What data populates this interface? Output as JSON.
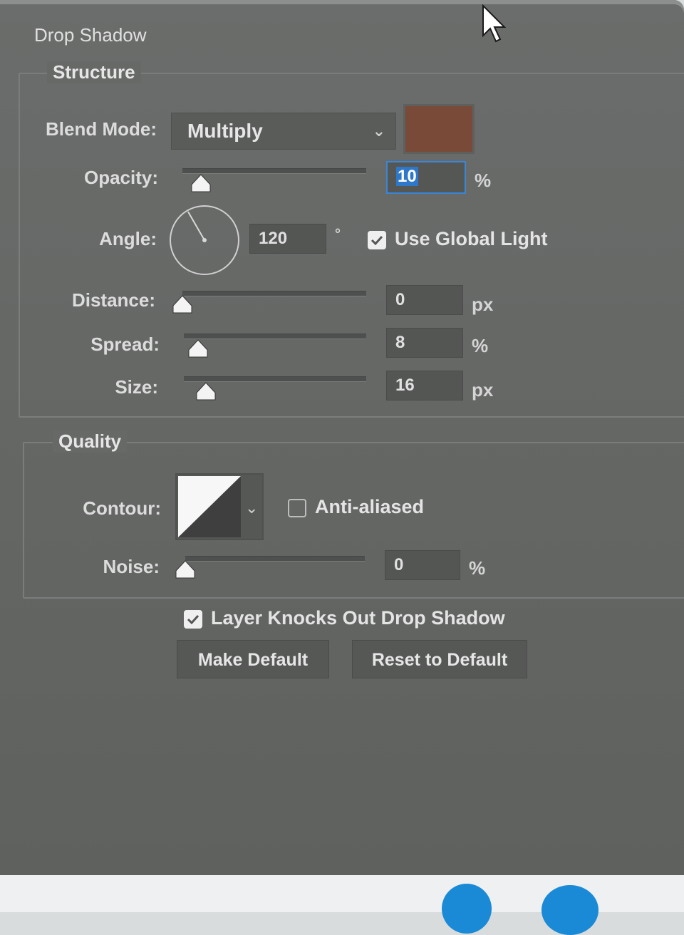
{
  "section": {
    "title": "Drop Shadow"
  },
  "structure": {
    "label": "Structure",
    "blend_mode": {
      "label": "Blend Mode:",
      "value": "Multiply",
      "color": "#7a4a38"
    },
    "opacity": {
      "label": "Opacity:",
      "value": "10",
      "unit": "%",
      "slider_fraction": 0.1
    },
    "angle": {
      "label": "Angle:",
      "value": "120",
      "unit": "°",
      "degrees": 120
    },
    "use_global_light": {
      "label": "Use Global Light",
      "checked": true
    },
    "distance": {
      "label": "Distance:",
      "value": "0",
      "unit": "px",
      "slider_fraction": 0.0
    },
    "spread": {
      "label": "Spread:",
      "value": "8",
      "unit": "%",
      "slider_fraction": 0.08
    },
    "size": {
      "label": "Size:",
      "value": "16",
      "unit": "px",
      "slider_fraction": 0.12
    }
  },
  "quality": {
    "label": "Quality",
    "contour": {
      "label": "Contour:"
    },
    "anti_aliased": {
      "label": "Anti-aliased",
      "checked": false
    },
    "noise": {
      "label": "Noise:",
      "value": "0",
      "unit": "%",
      "slider_fraction": 0.0
    }
  },
  "layer_knocks_out": {
    "label": "Layer Knocks Out Drop Shadow",
    "checked": true
  },
  "buttons": {
    "make_default": "Make Default",
    "reset_default": "Reset to Default"
  }
}
